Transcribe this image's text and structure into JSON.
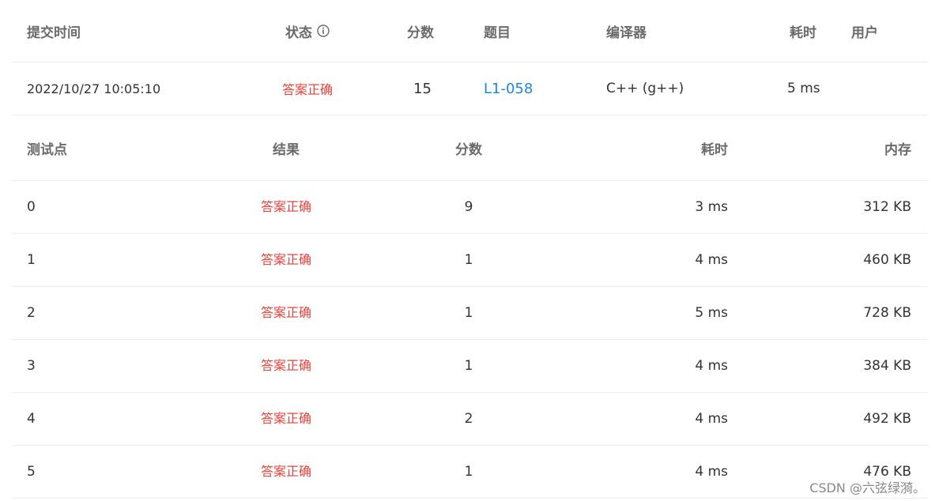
{
  "submission": {
    "headers": {
      "submit_time": "提交时间",
      "status": "状态",
      "score": "分数",
      "problem": "题目",
      "compiler": "编译器",
      "time": "耗时",
      "user": "用户"
    },
    "row": {
      "submit_time": "2022/10/27 10:05:10",
      "status": "答案正确",
      "score": "15",
      "problem": "L1-058",
      "compiler": "C++ (g++)",
      "time": "5 ms",
      "user": ""
    }
  },
  "testcases": {
    "headers": {
      "case": "测试点",
      "result": "结果",
      "score": "分数",
      "time": "耗时",
      "memory": "内存"
    },
    "rows": [
      {
        "case": "0",
        "result": "答案正确",
        "score": "9",
        "time": "3 ms",
        "memory": "312 KB"
      },
      {
        "case": "1",
        "result": "答案正确",
        "score": "1",
        "time": "4 ms",
        "memory": "460 KB"
      },
      {
        "case": "2",
        "result": "答案正确",
        "score": "1",
        "time": "5 ms",
        "memory": "728 KB"
      },
      {
        "case": "3",
        "result": "答案正确",
        "score": "1",
        "time": "4 ms",
        "memory": "384 KB"
      },
      {
        "case": "4",
        "result": "答案正确",
        "score": "2",
        "time": "4 ms",
        "memory": "492 KB"
      },
      {
        "case": "5",
        "result": "答案正确",
        "score": "1",
        "time": "4 ms",
        "memory": "476 KB"
      }
    ]
  },
  "colors": {
    "accepted": "#e5433b",
    "link": "#1e88e5",
    "border": "#ebeef5"
  },
  "icons": {
    "status_info": "info-circle-icon"
  },
  "watermark": "CSDN @六弦绿漪。"
}
